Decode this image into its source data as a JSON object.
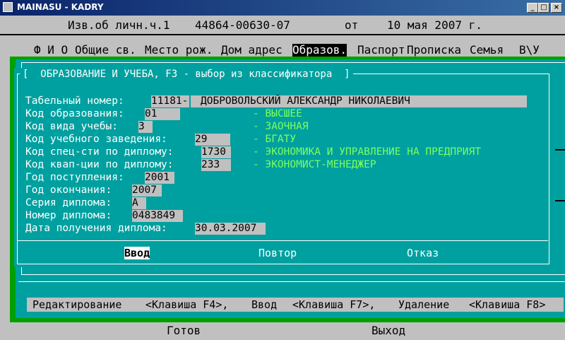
{
  "window": {
    "title": "MAINASU - KADRY",
    "minimize": "_",
    "maximize": "□",
    "close": "×"
  },
  "header": {
    "doc_type": "Изв.об личн.ч.1",
    "doc_number": "44864-00630-07",
    "from_label": "от",
    "doc_date": "10 мая 2007 г."
  },
  "menu": {
    "items": [
      {
        "label": "Ф И О",
        "active": false
      },
      {
        "label": "Общие св.",
        "active": false
      },
      {
        "label": "Место рож.",
        "active": false
      },
      {
        "label": "Дом адрес",
        "active": false
      },
      {
        "label": "Образов.",
        "active": true
      },
      {
        "label": "Паспорт",
        "active": false
      },
      {
        "label": "Прописка",
        "active": false
      },
      {
        "label": "Семья",
        "active": false
      },
      {
        "label": "В\\У",
        "active": false
      }
    ]
  },
  "dialog": {
    "title": "[  ОБРАЗОВАНИЕ И УЧЕБА, F3 - выбор из классификатора  ]",
    "tab_number_label": "Табельный номер:",
    "tab_number": "11181-",
    "full_name": "ДОБРОВОЛЬСКИЙ АЛЕКСАНДР НИКОЛАЕВИЧ",
    "fields": [
      {
        "label": "Код образования:",
        "value": "01",
        "desc": "- ВЫСШЕЕ"
      },
      {
        "label": "Код вида учебы:",
        "value": "3",
        "desc": "- ЗАОЧНАЯ"
      },
      {
        "label": "Код учебного заведения:",
        "value": "29",
        "desc": "- БГАТУ"
      },
      {
        "label": "Код спец-сти по диплому:",
        "value": "1730",
        "desc": "- ЭКОНОМИКА И УПРАВЛЕНИЕ НА ПРЕДПРИЯТ"
      },
      {
        "label": "Код квап-ции по диплому:",
        "value": "233",
        "desc": "- ЭКОНОМИСТ-МЕНЕДЖЕР"
      },
      {
        "label": "Год поступления:",
        "value": "2001"
      },
      {
        "label": "Год окончания:",
        "value": "2007"
      },
      {
        "label": "Серия диплома:",
        "value": "А"
      },
      {
        "label": "Номер диплома:",
        "value": "0483849"
      },
      {
        "label": "Дата получения диплома:",
        "value": "30.03.2007"
      }
    ],
    "buttons": {
      "enter": "Ввод",
      "repeat": "Повтор",
      "cancel": "Отказ"
    }
  },
  "statusbar": {
    "edit": "Редактирование",
    "edit_key": "<Клавиша F4>,",
    "enter": "Ввод",
    "enter_key": "<Клавиша F7>,",
    "delete": "Удаление",
    "delete_key": "<Клавиша F8>"
  },
  "bottom": {
    "ready": "Готов",
    "exit": "Выход"
  },
  "colors": {
    "cyan": "#00a0a0",
    "green_frame": "#00a000",
    "desc_text": "#7cff5c",
    "console_gray": "#c0c0c0"
  }
}
